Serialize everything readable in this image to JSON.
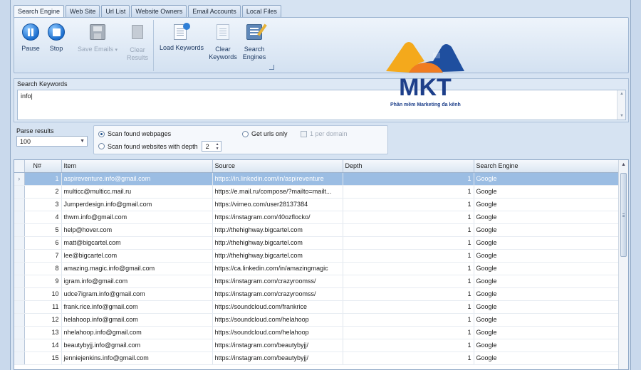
{
  "tabs": [
    "Search Engine",
    "Web Site",
    "Url List",
    "Website Owners",
    "Email Accounts",
    "Local Files"
  ],
  "toolbar": {
    "pause": "Pause",
    "stop": "Stop",
    "save_emails": "Save Emails",
    "clear_results_1": "Clear",
    "clear_results_2": "Results",
    "load_keywords": "Load Keywords",
    "clear_keywords_1": "Clear",
    "clear_keywords_2": "Keywords",
    "search_engines_1": "Search",
    "search_engines_2": "Engines"
  },
  "keywords": {
    "label": "Search Keywords",
    "value": "info"
  },
  "parse": {
    "label": "Parse results",
    "value": "100"
  },
  "scan": {
    "found_webpages": "Scan found webpages",
    "found_websites": "Scan found websites with depth",
    "depth": "2",
    "get_urls_only": "Get urls only",
    "one_per_domain": "1 per domain"
  },
  "grid": {
    "columns": [
      "N#",
      "Item",
      "Source",
      "Depth",
      "Search Engine"
    ],
    "rows": [
      {
        "n": "1",
        "item": "aspireventure.info@gmail.com",
        "source": "https://in.linkedin.com/in/aspireventure",
        "depth": "1",
        "engine": "Google"
      },
      {
        "n": "2",
        "item": "multicc@multicc.mail.ru",
        "source": "https://e.mail.ru/compose/?mailto=mailt...",
        "depth": "1",
        "engine": "Google"
      },
      {
        "n": "3",
        "item": "Jumperdesign.info@gmail.com",
        "source": "https://vimeo.com/user28137384",
        "depth": "1",
        "engine": "Google"
      },
      {
        "n": "4",
        "item": "thwm.info@gmail.com",
        "source": "https://instagram.com/40ozflocko/",
        "depth": "1",
        "engine": "Google"
      },
      {
        "n": "5",
        "item": "help@hover.com",
        "source": "http://thehighway.bigcartel.com",
        "depth": "1",
        "engine": "Google"
      },
      {
        "n": "6",
        "item": "matt@bigcartel.com",
        "source": "http://thehighway.bigcartel.com",
        "depth": "1",
        "engine": "Google"
      },
      {
        "n": "7",
        "item": "lee@bigcartel.com",
        "source": "http://thehighway.bigcartel.com",
        "depth": "1",
        "engine": "Google"
      },
      {
        "n": "8",
        "item": "amazing.magic.info@gmail.com",
        "source": "https://ca.linkedin.com/in/amazingmagic",
        "depth": "1",
        "engine": "Google"
      },
      {
        "n": "9",
        "item": "igram.info@gmail.com",
        "source": "https://instagram.com/crazyroomss/",
        "depth": "1",
        "engine": "Google"
      },
      {
        "n": "10",
        "item": "udce7igram.info@gmail.com",
        "source": "https://instagram.com/crazyroomss/",
        "depth": "1",
        "engine": "Google"
      },
      {
        "n": "11",
        "item": "frank.rice.info@gmail.com",
        "source": "https://soundcloud.com/frankrice",
        "depth": "1",
        "engine": "Google"
      },
      {
        "n": "12",
        "item": "helahoop.info@gmail.com",
        "source": "https://soundcloud.com/helahoop",
        "depth": "1",
        "engine": "Google"
      },
      {
        "n": "13",
        "item": "nhelahoop.info@gmail.com",
        "source": "https://soundcloud.com/helahoop",
        "depth": "1",
        "engine": "Google"
      },
      {
        "n": "14",
        "item": "beautybyjj.info@gmail.com",
        "source": "https://instagram.com/beautybyjj/",
        "depth": "1",
        "engine": "Google"
      },
      {
        "n": "15",
        "item": "jenniejenkins.info@gmail.com",
        "source": "https://instagram.com/beautybyjj/",
        "depth": "1",
        "engine": "Google"
      }
    ]
  },
  "watermark": {
    "brand": "MKT",
    "tagline": "Phần mềm Marketing đa kênh"
  },
  "colors": {
    "selected_row": "#9bbde3",
    "accent": "#1c6fcf"
  }
}
